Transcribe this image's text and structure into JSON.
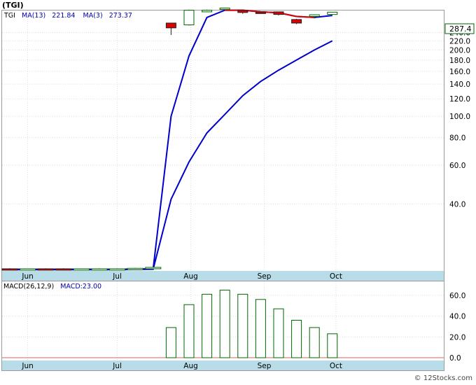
{
  "title": "(TGI)",
  "legend": {
    "ticker": "TGI",
    "ma13_label": "MA(13)",
    "ma13_value": "221.84",
    "ma3_label": "MA(3)",
    "ma3_value": "273.37"
  },
  "last_price": "287.4",
  "macd_legend": {
    "label": "MACD(26,12,9)",
    "value_label": "MACD:23.00"
  },
  "watermark": "© 12Stocks.com",
  "colors": {
    "ma_blue": "#0000cc",
    "ma_red": "#dd0000",
    "up_candle_edge": "#006600",
    "down_candle": "#dd0000",
    "axis_band": "#b8dde8",
    "macd_bar": "#006600",
    "legend_text": "#0000aa"
  },
  "chart_data": [
    {
      "type": "candlestick",
      "yscale": "log",
      "ylim": [
        20,
        300
      ],
      "yticks": [
        {
          "value": 240,
          "label": "240.0"
        },
        {
          "value": 220,
          "label": "220.0"
        },
        {
          "value": 200,
          "label": "200.0"
        },
        {
          "value": 180,
          "label": "180.0"
        },
        {
          "value": 160,
          "label": "160.0"
        },
        {
          "value": 140,
          "label": "140.0"
        },
        {
          "value": 120,
          "label": "120.0"
        },
        {
          "value": 100,
          "label": "100.0"
        },
        {
          "value": 80,
          "label": "80.0"
        },
        {
          "value": 60,
          "label": "60.0"
        },
        {
          "value": 40,
          "label": "40.0"
        }
      ],
      "xticks": [
        {
          "x": 1.0,
          "label": "Jun"
        },
        {
          "x": 6.0,
          "label": "Jul"
        },
        {
          "x": 10.1,
          "label": "Aug"
        },
        {
          "x": 14.2,
          "label": "Sep"
        },
        {
          "x": 18.2,
          "label": "Oct"
        }
      ],
      "candles": [
        {
          "x": 0,
          "open": 20.3,
          "high": 20.4,
          "close": 20.2,
          "low": 20.1
        },
        {
          "x": 1,
          "open": 20.2,
          "high": 20.3,
          "close": 20.3,
          "low": 20.1
        },
        {
          "x": 2,
          "open": 20.3,
          "high": 20.4,
          "close": 20.2,
          "low": 20.1
        },
        {
          "x": 3,
          "open": 20.3,
          "high": 20.4,
          "close": 20.2,
          "low": 20.0
        },
        {
          "x": 4,
          "open": 20.2,
          "high": 20.3,
          "close": 20.3,
          "low": 20.1
        },
        {
          "x": 5,
          "open": 20.3,
          "high": 20.4,
          "close": 20.3,
          "low": 20.1
        },
        {
          "x": 6,
          "open": 20.3,
          "high": 20.4,
          "close": 20.3,
          "low": 20.1
        },
        {
          "x": 7,
          "open": 20.3,
          "high": 20.5,
          "close": 20.4,
          "low": 20.1
        },
        {
          "x": 8,
          "open": 20.4,
          "high": 20.8,
          "close": 20.6,
          "low": 20.2
        },
        {
          "x": 9,
          "open": 265,
          "high": 265,
          "close": 252,
          "low": 234
        },
        {
          "x": 10,
          "open": 260,
          "high": 305,
          "close": 303,
          "low": 258
        },
        {
          "x": 11,
          "open": 298,
          "high": 305,
          "close": 303,
          "low": 297
        },
        {
          "x": 12,
          "open": 306,
          "high": 310,
          "close": 310,
          "low": 304
        },
        {
          "x": 13,
          "open": 303,
          "high": 304,
          "close": 296,
          "low": 292
        },
        {
          "x": 14,
          "open": 297,
          "high": 299,
          "close": 296,
          "low": 295
        },
        {
          "x": 15,
          "open": 298,
          "high": 299,
          "close": 290,
          "low": 287
        },
        {
          "x": 16,
          "open": 275,
          "high": 277,
          "close": 265,
          "low": 262
        },
        {
          "x": 17,
          "open": 284,
          "high": 290,
          "close": 289,
          "low": 278
        },
        {
          "x": 18,
          "open": 290,
          "high": 297,
          "close": 297,
          "low": 290
        }
      ],
      "series": [
        {
          "name": "MA(13)",
          "x": [
            0,
            2,
            4,
            6,
            8,
            9,
            10,
            11,
            12,
            13,
            14,
            15,
            16,
            17,
            18
          ],
          "y": [
            20.1,
            20.1,
            20.1,
            20.1,
            20.2,
            42,
            62,
            84,
            102,
            124,
            144,
            162,
            180,
            200,
            220
          ]
        },
        {
          "name": "MA(3)",
          "x": [
            0,
            2,
            4,
            6,
            8,
            9,
            10,
            11,
            12,
            13,
            14,
            15,
            16,
            17,
            18
          ],
          "y": [
            20.2,
            20.2,
            20.2,
            20.2,
            20.3,
            100,
            188,
            281,
            303,
            303,
            298,
            295,
            284,
            281,
            287
          ]
        }
      ]
    },
    {
      "type": "bar",
      "ylim": [
        -2,
        72
      ],
      "yticks": [
        {
          "value": 60,
          "label": "60.0"
        },
        {
          "value": 40,
          "label": "40.0"
        },
        {
          "value": 20,
          "label": "20.0"
        },
        {
          "value": 0,
          "label": "0.0"
        }
      ],
      "xticks": [
        {
          "x": 1.0,
          "label": "Jun"
        },
        {
          "x": 6.0,
          "label": "Jul"
        },
        {
          "x": 10.1,
          "label": "Aug"
        },
        {
          "x": 14.2,
          "label": "Sep"
        },
        {
          "x": 18.2,
          "label": "Oct"
        }
      ],
      "x": [
        0,
        1,
        2,
        3,
        4,
        5,
        6,
        7,
        8,
        9,
        10,
        11,
        12,
        13,
        14,
        15,
        16,
        17,
        18
      ],
      "values": [
        0,
        0,
        0,
        0,
        0,
        0,
        0,
        0,
        0,
        29,
        51,
        61,
        65,
        61,
        56,
        47,
        36,
        29,
        23
      ]
    }
  ]
}
